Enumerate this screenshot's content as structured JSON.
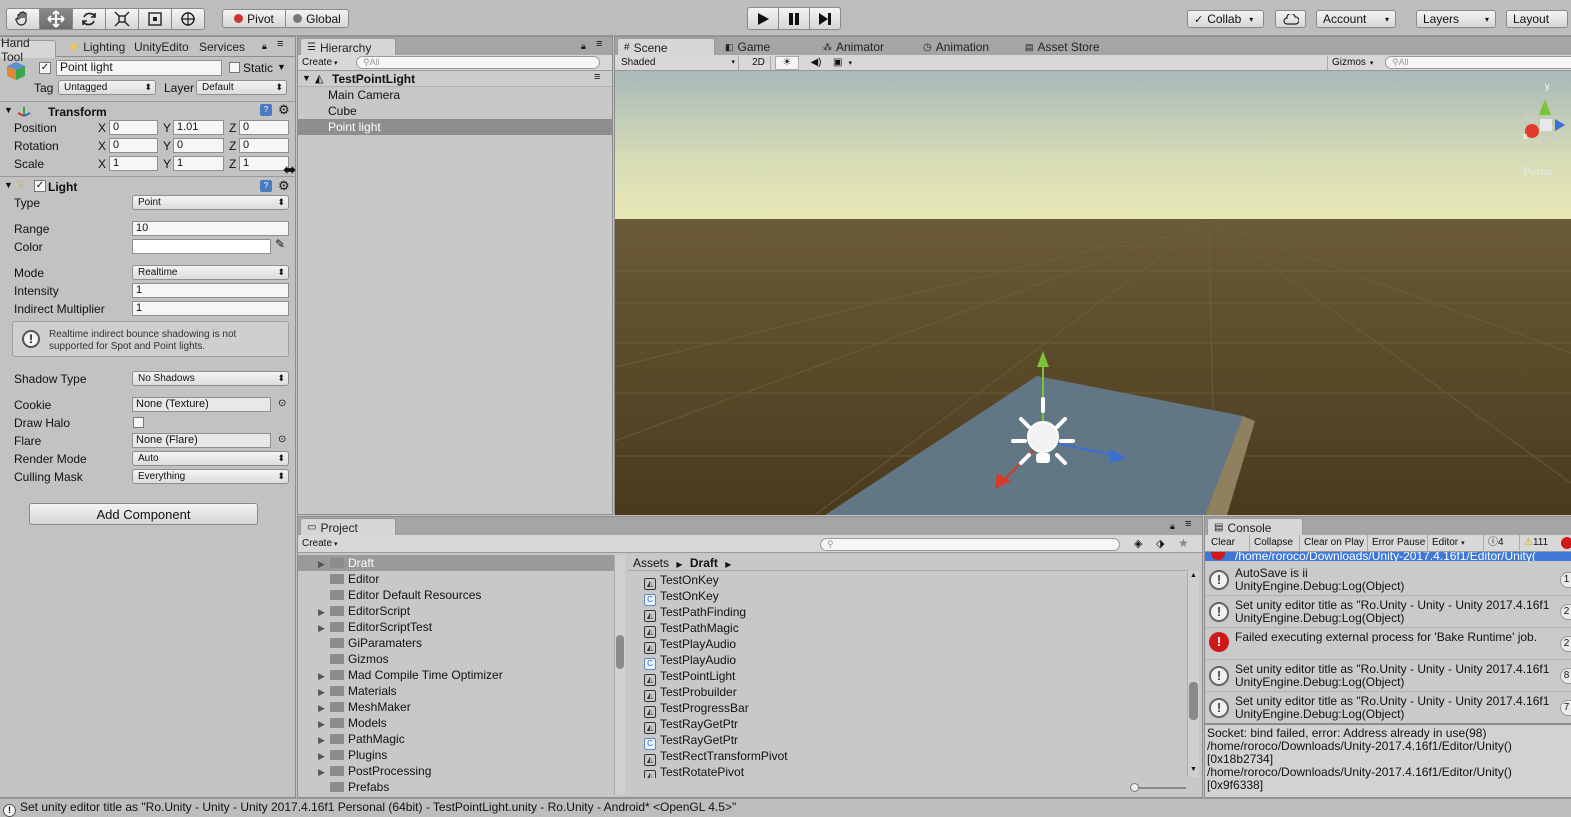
{
  "toolbar": {
    "tools": [
      "hand-tool-icon",
      "move-tool-icon",
      "rotate-tool-icon",
      "scale-tool-icon",
      "rect-tool-icon",
      "transform-tool-icon"
    ],
    "pivot": "Pivot",
    "global": "Global",
    "collab": "Collab",
    "account": "Account",
    "layers": "Layers",
    "layout": "Layout"
  },
  "inspector": {
    "tabs": {
      "inspector": "Hand Tool",
      "lighting": "Lighting",
      "unity_editor": "UnityEdito",
      "services": "Services"
    },
    "object_name": "Point light",
    "static_label": "Static",
    "tag_label": "Tag",
    "tag_value": "Untagged",
    "layer_label": "Layer",
    "layer_value": "Default",
    "transform": {
      "title": "Transform",
      "position_label": "Position",
      "rotation_label": "Rotation",
      "scale_label": "Scale",
      "position": {
        "x": "0",
        "y": "1.01",
        "z": "0"
      },
      "rotation": {
        "x": "0",
        "y": "0",
        "z": "0"
      },
      "scale": {
        "x": "1",
        "y": "1",
        "z": "1"
      },
      "x": "X",
      "y": "Y",
      "z": "Z"
    },
    "light": {
      "title": "Light",
      "type_label": "Type",
      "type_value": "Point",
      "range_label": "Range",
      "range_value": "10",
      "color_label": "Color",
      "mode_label": "Mode",
      "mode_value": "Realtime",
      "intensity_label": "Intensity",
      "intensity_value": "1",
      "indirect_label": "Indirect Multiplier",
      "indirect_value": "1",
      "help_text_1": "Realtime indirect bounce shadowing is not",
      "help_text_2": "supported for Spot and Point lights.",
      "shadow_label": "Shadow Type",
      "shadow_value": "No Shadows",
      "cookie_label": "Cookie",
      "cookie_value": "None (Texture)",
      "halo_label": "Draw Halo",
      "flare_label": "Flare",
      "flare_value": "None (Flare)",
      "render_label": "Render Mode",
      "render_value": "Auto",
      "culling_label": "Culling Mask",
      "culling_value": "Everything"
    },
    "add_component": "Add Component"
  },
  "hierarchy": {
    "tab": "Hierarchy",
    "create": "Create",
    "search_placeholder": "All",
    "scene": "TestPointLight",
    "items": [
      "Main Camera",
      "Cube",
      "Point light"
    ]
  },
  "scene_view": {
    "tabs": {
      "scene": "Scene",
      "game": "Game",
      "animator": "Animator",
      "animation": "Animation",
      "asset_store": "Asset Store"
    },
    "shading": "Shaded",
    "mode_2d": "2D",
    "gizmos": "Gizmos",
    "search_placeholder": "All",
    "persp": "Persp",
    "gizmo_x": "x",
    "gizmo_y": "y"
  },
  "project": {
    "tab": "Project",
    "create": "Create",
    "folders": [
      "Draft",
      "Editor",
      "Editor Default Resources",
      "EditorScript",
      "EditorScriptTest",
      "GiParamaters",
      "Gizmos",
      "Mad Compile Time Optimizer",
      "Materials",
      "MeshMaker",
      "Models",
      "PathMagic",
      "Plugins",
      "PostProcessing",
      "Prefabs"
    ],
    "breadcrumb_root": "Assets",
    "breadcrumb_current": "Draft",
    "assets": [
      {
        "name": "TestOnKey",
        "kind": "unity"
      },
      {
        "name": "TestOnKey",
        "kind": "cs"
      },
      {
        "name": "TestPathFinding",
        "kind": "unity"
      },
      {
        "name": "TestPathMagic",
        "kind": "unity"
      },
      {
        "name": "TestPlayAudio",
        "kind": "unity"
      },
      {
        "name": "TestPlayAudio",
        "kind": "cs"
      },
      {
        "name": "TestPointLight",
        "kind": "unity"
      },
      {
        "name": "TestProbuilder",
        "kind": "unity"
      },
      {
        "name": "TestProgressBar",
        "kind": "unity"
      },
      {
        "name": "TestRayGetPtr",
        "kind": "unity"
      },
      {
        "name": "TestRayGetPtr",
        "kind": "cs"
      },
      {
        "name": "TestRectTransformPivot",
        "kind": "unity"
      },
      {
        "name": "TestRotatePivot",
        "kind": "unity"
      }
    ]
  },
  "console": {
    "tab": "Console",
    "clear": "Clear",
    "collapse": "Collapse",
    "clear_on_play": "Clear on Play",
    "error_pause": "Error Pause",
    "editor": "Editor",
    "info_count": "4",
    "warn_count": "111",
    "top_partial": "/home/roroco/Downloads/Unity-2017.4.16f1/Editor/Unity(",
    "entries": [
      {
        "kind": "info",
        "line1": "AutoSave is ii",
        "line2": "UnityEngine.Debug:Log(Object)",
        "count": "1"
      },
      {
        "kind": "info",
        "line1": "Set unity editor title as \"Ro.Unity - Unity - Unity 2017.4.16f1",
        "line2": "UnityEngine.Debug:Log(Object)",
        "count": "2"
      },
      {
        "kind": "error",
        "line1": "Failed executing external process for 'Bake Runtime' job.",
        "line2": "",
        "count": "2"
      },
      {
        "kind": "info",
        "line1": "Set unity editor title as \"Ro.Unity - Unity - Unity 2017.4.16f1",
        "line2": "UnityEngine.Debug:Log(Object)",
        "count": "8"
      },
      {
        "kind": "info",
        "line1": "Set unity editor title as \"Ro.Unity - Unity - Unity 2017.4.16f1",
        "line2": "UnityEngine.Debug:Log(Object)",
        "count": "7"
      }
    ],
    "detail": [
      "Socket: bind failed, error: Address already in use(98)",
      "/home/roroco/Downloads/Unity-2017.4.16f1/Editor/Unity()",
      "[0x18b2734]",
      "/home/roroco/Downloads/Unity-2017.4.16f1/Editor/Unity()",
      "[0x9f6338]"
    ]
  },
  "status_bar": "Set unity editor title as \"Ro.Unity - Unity - Unity 2017.4.16f1 Personal (64bit) - TestPointLight.unity - Ro.Unity - Android* <OpenGL 4.5>\""
}
